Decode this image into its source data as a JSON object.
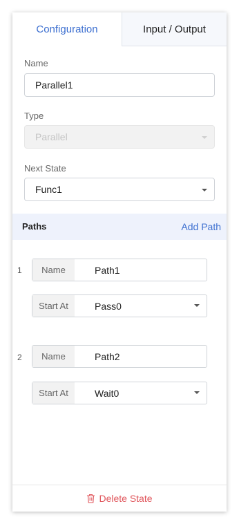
{
  "tabs": {
    "configuration": "Configuration",
    "input_output": "Input / Output"
  },
  "name_field": {
    "label": "Name",
    "value": "Parallel1"
  },
  "type_field": {
    "label": "Type",
    "value": "Parallel"
  },
  "next_state_field": {
    "label": "Next State",
    "value": "Func1"
  },
  "paths_section": {
    "title": "Paths",
    "add_label": "Add Path",
    "items": [
      {
        "index": "1",
        "name_label": "Name",
        "name_value": "Path1",
        "start_label": "Start At",
        "start_value": "Pass0"
      },
      {
        "index": "2",
        "name_label": "Name",
        "name_value": "Path2",
        "start_label": "Start At",
        "start_value": "Wait0"
      }
    ]
  },
  "footer": {
    "delete_label": "Delete State"
  },
  "colors": {
    "accent": "#3c6fd0",
    "danger": "#e0555b",
    "section_bg": "#eef2fc"
  },
  "icons": [
    "chevron-down-icon",
    "trash-icon"
  ]
}
